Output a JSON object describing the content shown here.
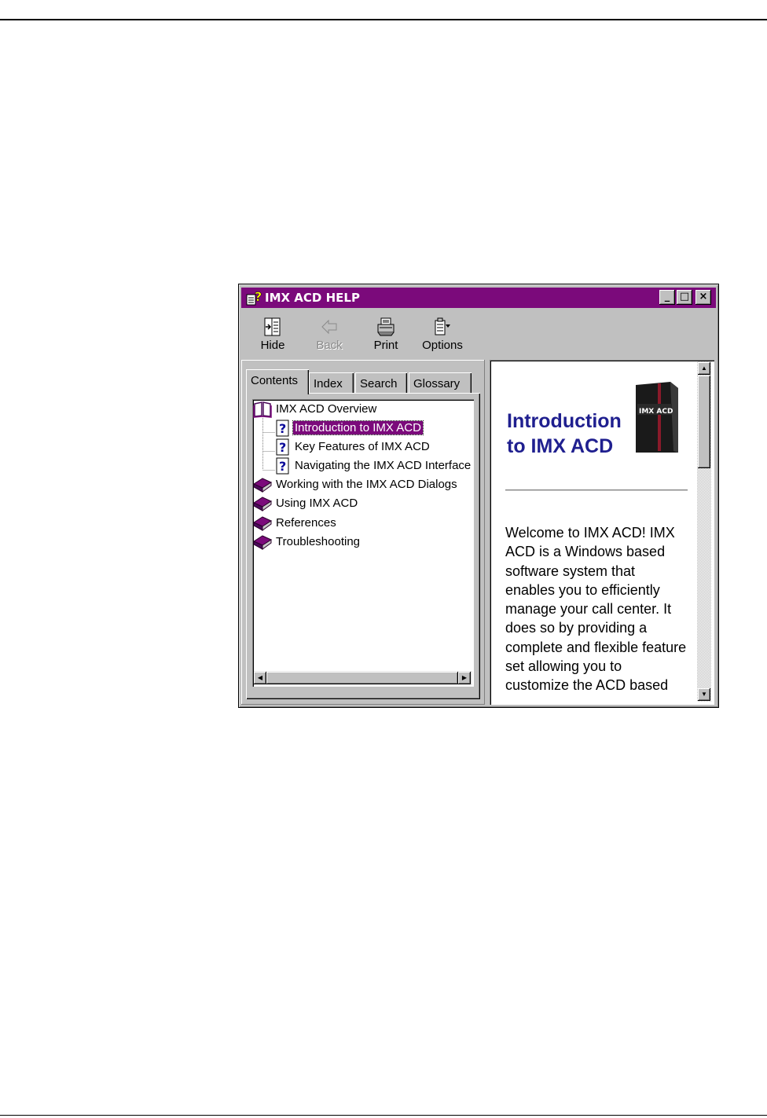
{
  "window": {
    "title": "IMX ACD HELP",
    "title_bar_color": "#7b0a7b",
    "icon": "help-book-icon",
    "controls": {
      "minimize": "_",
      "maximize": "□",
      "close": "×"
    }
  },
  "toolbar": {
    "hide": {
      "label": "Hide",
      "icon": "hide-pane-icon"
    },
    "back": {
      "label": "Back",
      "icon": "back-arrow-icon",
      "disabled": true
    },
    "print": {
      "label": "Print",
      "icon": "printer-icon"
    },
    "options": {
      "label": "Options",
      "icon": "options-icon"
    }
  },
  "tabs": {
    "contents": "Contents",
    "index": "Index",
    "search": "Search",
    "glossary": "Glossary",
    "active": "Contents"
  },
  "tree": {
    "items": [
      {
        "label": "IMX ACD Overview",
        "icon": "open-book-icon"
      },
      {
        "label": "Introduction to IMX ACD",
        "icon": "help-page-icon",
        "selected": true
      },
      {
        "label": "Key Features of IMX ACD",
        "icon": "help-page-icon"
      },
      {
        "label": "Navigating the IMX ACD Interface",
        "icon": "help-page-icon"
      },
      {
        "label": "Working with the IMX ACD Dialogs",
        "icon": "closed-book-icon"
      },
      {
        "label": "Using IMX ACD",
        "icon": "closed-book-icon"
      },
      {
        "label": "References",
        "icon": "closed-book-icon"
      },
      {
        "label": "Troubleshooting",
        "icon": "closed-book-icon"
      }
    ],
    "selection_color": "#7b0a7b"
  },
  "article": {
    "title_line1": "Introduction",
    "title_line2": "to IMX ACD",
    "title_color": "#1f1f8f",
    "image_label": "IMX ACD",
    "body": "Welcome to IMX ACD! IMX ACD is a Windows based software system that enables you to efficiently manage your call center. It does so by providing a complete and flexible feature set allowing you to customize the ACD based"
  }
}
